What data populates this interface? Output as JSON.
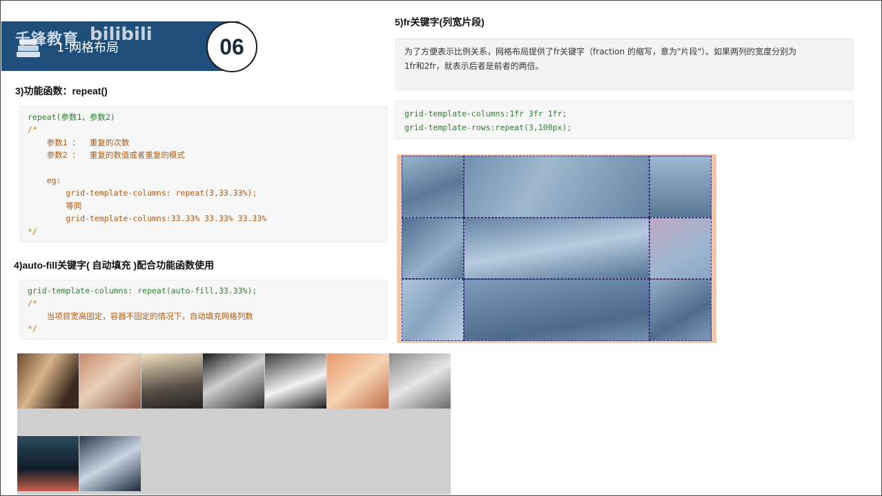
{
  "header": {
    "logo_text": "千锋教育",
    "bili_text": "bilibili",
    "title": "1-网格布局",
    "badge": "06"
  },
  "section3": {
    "heading": "3)功能函数：repeat()",
    "code": [
      {
        "t": "repeat(参数1，参数2)",
        "c": "kw"
      },
      {
        "t": "/*",
        "c": "cm"
      },
      {
        "t": "    参数1 ：  重复的次数",
        "c": "tx"
      },
      {
        "t": "    参数2 ：  重复的数值或者重复的模式",
        "c": "tx"
      },
      {
        "t": "",
        "c": "tx"
      },
      {
        "t": "    eg:",
        "c": "tx"
      },
      {
        "t": "        grid-template-columns: repeat(3,33.33%);",
        "c": "tx"
      },
      {
        "t": "        等同",
        "c": "tx"
      },
      {
        "t": "        grid-template-columns:33.33% 33.33% 33.33%",
        "c": "tx"
      },
      {
        "t": "*/",
        "c": "cm"
      }
    ]
  },
  "section4": {
    "heading": "4)auto-fill关键字( 自动填充 )配合功能函数使用",
    "code": [
      {
        "t": "grid-template-columns: repeat(auto-fill,33.33%);",
        "c": "kw"
      },
      {
        "t": "/*",
        "c": "cm"
      },
      {
        "t": "    当项目宽高固定，容器不固定的情况下，自动填充网格列数",
        "c": "tx"
      },
      {
        "t": "*/",
        "c": "cm"
      }
    ]
  },
  "section5": {
    "heading": "5)fr关键字(列宽片段)",
    "note_line1": "为了方便表示比例关系，网格布局提供了fr关键字（fraction 的缩写，意为\"片段\"）。如果两列的宽度分别为",
    "note_line2": "1fr和2fr，就表示后者是前者的两倍。",
    "code": [
      {
        "t": "grid-template-columns:1fr 3fr 1fr;",
        "c": "kw"
      },
      {
        "t": "grid-template-rows:repeat(3,100px);",
        "c": "kw"
      }
    ]
  },
  "colors": {
    "banner": "#1f4e7a",
    "code_keyword": "#2f7d32",
    "code_comment": "#c47a1c",
    "fr_border": "#f3c7a4"
  }
}
